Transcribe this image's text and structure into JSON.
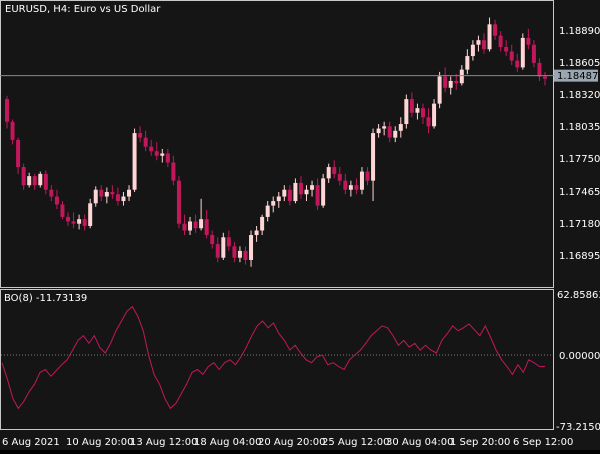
{
  "window": {
    "symbol": "EURUSD",
    "timeframe": "H4",
    "description": "Euro vs US Dollar",
    "header_text": "EURUSD, H4:  Euro vs US Dollar"
  },
  "colors": {
    "background": "#151515",
    "frame": "#c8c8c8",
    "text": "#ffffff",
    "bull": "#ffd6d6",
    "bear": "#c2185b",
    "indicator_line": "#c2185b",
    "price_line": "#8a8a8a",
    "price_label_bg": "#9aa7b2",
    "price_label_text": "#000000",
    "zero_line": "#777777"
  },
  "price_axis": {
    "ticks": [
      "1.18890",
      "1.18605",
      "1.18320",
      "1.18035",
      "1.17750",
      "1.17465",
      "1.17180",
      "1.16895"
    ],
    "current_price": "1.18487"
  },
  "indicator": {
    "label": "BO(8) -11.73139",
    "ticks": [
      "62.85863",
      "0.00000",
      "-73.21501"
    ]
  },
  "time_axis": {
    "labels": [
      "6 Aug 2021",
      "10 Aug 20:00",
      "13 Aug 12:00",
      "18 Aug 04:00",
      "20 Aug 20:00",
      "25 Aug 12:00",
      "30 Aug 04:00",
      "1 Sep 20:00",
      "6 Sep 12:00"
    ]
  },
  "chart_data": [
    {
      "type": "candlestick",
      "title": "EURUSD, H4:  Euro vs US Dollar",
      "ylim": [
        1.16775,
        1.19003
      ],
      "y_ticks": [
        1.1689,
        1.1718,
        1.1746,
        1.1775,
        1.18035,
        1.1832,
        1.18605,
        1.1889
      ],
      "current_price": 1.18487,
      "candles": [
        [
          1.1828,
          1.1831,
          1.1802,
          1.1808
        ],
        [
          1.1808,
          1.181,
          1.1788,
          1.1792
        ],
        [
          1.1792,
          1.1794,
          1.1762,
          1.1768
        ],
        [
          1.1768,
          1.1771,
          1.1748,
          1.1752
        ],
        [
          1.1752,
          1.1763,
          1.175,
          1.176
        ],
        [
          1.176,
          1.1762,
          1.1748,
          1.1752
        ],
        [
          1.1752,
          1.1764,
          1.175,
          1.1762
        ],
        [
          1.1762,
          1.1765,
          1.1744,
          1.1748
        ],
        [
          1.1748,
          1.1752,
          1.1738,
          1.1742
        ],
        [
          1.1742,
          1.1748,
          1.1731,
          1.1735
        ],
        [
          1.1735,
          1.1738,
          1.1722,
          1.1724
        ],
        [
          1.1724,
          1.1728,
          1.1716,
          1.172
        ],
        [
          1.172,
          1.1728,
          1.1714,
          1.1718
        ],
        [
          1.1718,
          1.1726,
          1.1713,
          1.1722
        ],
        [
          1.1722,
          1.1726,
          1.1712,
          1.1716
        ],
        [
          1.1716,
          1.174,
          1.1714,
          1.1736
        ],
        [
          1.1736,
          1.1751,
          1.1733,
          1.1748
        ],
        [
          1.1748,
          1.1752,
          1.1738,
          1.1742
        ],
        [
          1.1742,
          1.175,
          1.1736,
          1.1746
        ],
        [
          1.1746,
          1.1752,
          1.174,
          1.1744
        ],
        [
          1.1744,
          1.175,
          1.1734,
          1.1738
        ],
        [
          1.1738,
          1.1746,
          1.1734,
          1.1742
        ],
        [
          1.1742,
          1.1752,
          1.1738,
          1.1748
        ],
        [
          1.1748,
          1.1802,
          1.1746,
          1.1798
        ],
        [
          1.1798,
          1.1804,
          1.179,
          1.1794
        ],
        [
          1.1794,
          1.18,
          1.1782,
          1.1786
        ],
        [
          1.1786,
          1.1792,
          1.1778,
          1.1782
        ],
        [
          1.1782,
          1.179,
          1.1774,
          1.1778
        ],
        [
          1.1778,
          1.1784,
          1.1772,
          1.178
        ],
        [
          1.178,
          1.1784,
          1.1768,
          1.1772
        ],
        [
          1.1772,
          1.1778,
          1.1752,
          1.1756
        ],
        [
          1.1756,
          1.176,
          1.1714,
          1.1718
        ],
        [
          1.1718,
          1.1726,
          1.1708,
          1.1712
        ],
        [
          1.1712,
          1.1724,
          1.1708,
          1.172
        ],
        [
          1.172,
          1.1726,
          1.171,
          1.1714
        ],
        [
          1.1714,
          1.174,
          1.1712,
          1.1722
        ],
        [
          1.1722,
          1.173,
          1.1705,
          1.1708
        ],
        [
          1.1708,
          1.1712,
          1.1696,
          1.17
        ],
        [
          1.17,
          1.1706,
          1.1684,
          1.1688
        ],
        [
          1.1688,
          1.171,
          1.1686,
          1.1706
        ],
        [
          1.1706,
          1.1712,
          1.1694,
          1.1698
        ],
        [
          1.1698,
          1.1702,
          1.1684,
          1.1688
        ],
        [
          1.1688,
          1.1698,
          1.1684,
          1.1694
        ],
        [
          1.1694,
          1.1698,
          1.1682,
          1.1686
        ],
        [
          1.1686,
          1.1712,
          1.168,
          1.1708
        ],
        [
          1.1708,
          1.1716,
          1.1702,
          1.1712
        ],
        [
          1.1712,
          1.1726,
          1.1708,
          1.1724
        ],
        [
          1.1724,
          1.1738,
          1.172,
          1.1734
        ],
        [
          1.1734,
          1.1742,
          1.1728,
          1.1738
        ],
        [
          1.1738,
          1.1746,
          1.1732,
          1.1742
        ],
        [
          1.1742,
          1.1752,
          1.1738,
          1.1748
        ],
        [
          1.1748,
          1.1752,
          1.1734,
          1.1738
        ],
        [
          1.1738,
          1.1758,
          1.1736,
          1.1754
        ],
        [
          1.1754,
          1.176,
          1.174,
          1.1744
        ],
        [
          1.1744,
          1.1752,
          1.1738,
          1.1748
        ],
        [
          1.1748,
          1.1756,
          1.1742,
          1.1752
        ],
        [
          1.1752,
          1.1758,
          1.173,
          1.1734
        ],
        [
          1.1734,
          1.1762,
          1.1732,
          1.1758
        ],
        [
          1.1758,
          1.1771,
          1.1754,
          1.1768
        ],
        [
          1.1768,
          1.1774,
          1.1758,
          1.1762
        ],
        [
          1.1762,
          1.1768,
          1.1752,
          1.1756
        ],
        [
          1.1756,
          1.1762,
          1.1744,
          1.1748
        ],
        [
          1.1748,
          1.1756,
          1.1742,
          1.1752
        ],
        [
          1.1752,
          1.1758,
          1.1744,
          1.1748
        ],
        [
          1.1748,
          1.1768,
          1.1744,
          1.1764
        ],
        [
          1.1764,
          1.1768,
          1.1752,
          1.1756
        ],
        [
          1.1756,
          1.1802,
          1.1738,
          1.1798
        ],
        [
          1.1798,
          1.1806,
          1.1794,
          1.1802
        ],
        [
          1.1802,
          1.1808,
          1.1796,
          1.1804
        ],
        [
          1.1804,
          1.1808,
          1.179,
          1.1794
        ],
        [
          1.1794,
          1.1804,
          1.179,
          1.18
        ],
        [
          1.18,
          1.1812,
          1.1794,
          1.1806
        ],
        [
          1.1806,
          1.1832,
          1.1802,
          1.1828
        ],
        [
          1.1828,
          1.1834,
          1.1812,
          1.1816
        ],
        [
          1.1816,
          1.1824,
          1.181,
          1.182
        ],
        [
          1.182,
          1.1824,
          1.1806,
          1.1812
        ],
        [
          1.1812,
          1.182,
          1.1798,
          1.1804
        ],
        [
          1.1804,
          1.1828,
          1.1802,
          1.1824
        ],
        [
          1.1824,
          1.1852,
          1.182,
          1.1848
        ],
        [
          1.1848,
          1.1856,
          1.1834,
          1.1838
        ],
        [
          1.1838,
          1.1848,
          1.1832,
          1.1844
        ],
        [
          1.1844,
          1.185,
          1.1836,
          1.1842
        ],
        [
          1.1842,
          1.1858,
          1.184,
          1.1854
        ],
        [
          1.1854,
          1.1872,
          1.185,
          1.1866
        ],
        [
          1.1866,
          1.188,
          1.1862,
          1.1876
        ],
        [
          1.1876,
          1.1884,
          1.187,
          1.188
        ],
        [
          1.188,
          1.1886,
          1.1868,
          1.1872
        ],
        [
          1.1872,
          1.19,
          1.187,
          1.1894
        ],
        [
          1.1894,
          1.1898,
          1.188,
          1.1884
        ],
        [
          1.1884,
          1.1888,
          1.187,
          1.1874
        ],
        [
          1.1874,
          1.188,
          1.1866,
          1.187
        ],
        [
          1.187,
          1.1876,
          1.1858,
          1.1862
        ],
        [
          1.1862,
          1.1868,
          1.1852,
          1.1856
        ],
        [
          1.1856,
          1.1886,
          1.1854,
          1.1882
        ],
        [
          1.1882,
          1.189,
          1.1872,
          1.1876
        ],
        [
          1.1876,
          1.188,
          1.1856,
          1.186
        ],
        [
          1.186,
          1.1864,
          1.1844,
          1.1848
        ],
        [
          1.1848,
          1.1852,
          1.184,
          1.1846
        ]
      ]
    },
    {
      "type": "line",
      "title": "BO(8) -11.73139",
      "ylim": [
        -73.21501,
        62.85863
      ],
      "y_ticks": [
        62.85863,
        0.0,
        -73.21501
      ],
      "series": [
        {
          "values": [
            -8,
            -25,
            -45,
            -55,
            -48,
            -38,
            -30,
            -18,
            -15,
            -22,
            -16,
            -10,
            -5,
            5,
            15,
            20,
            12,
            20,
            8,
            2,
            12,
            25,
            35,
            45,
            50,
            40,
            25,
            0,
            -20,
            -30,
            -45,
            -55,
            -50,
            -40,
            -30,
            -18,
            -15,
            -20,
            -12,
            -8,
            -15,
            -8,
            -5,
            -10,
            -2,
            8,
            20,
            30,
            35,
            28,
            33,
            22,
            15,
            5,
            10,
            2,
            -5,
            -8,
            -2,
            0,
            -10,
            -8,
            -12,
            -15,
            -5,
            0,
            5,
            12,
            20,
            25,
            30,
            28,
            20,
            10,
            15,
            8,
            12,
            5,
            10,
            5,
            2,
            15,
            22,
            30,
            25,
            28,
            32,
            26,
            20,
            30,
            18,
            5,
            -5,
            -12,
            -20,
            -10,
            -18,
            -5,
            -8,
            -12,
            -11.73
          ]
        }
      ]
    }
  ]
}
